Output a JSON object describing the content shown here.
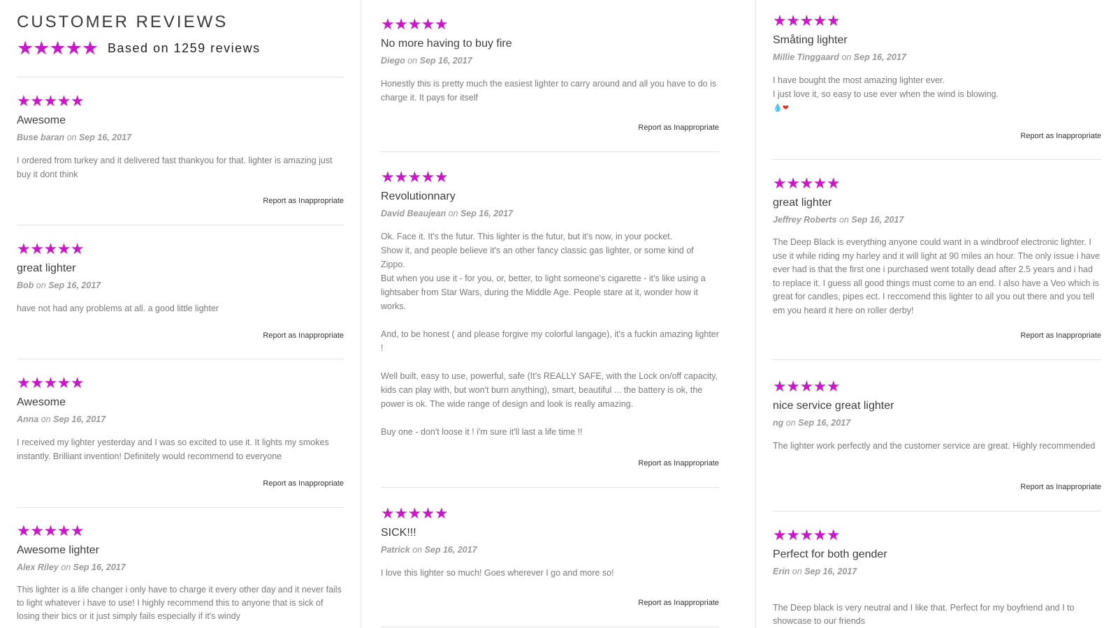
{
  "header": {
    "title": "CUSTOMER REVIEWS",
    "stars": "★★★★★",
    "summary": "Based on 1259 reviews"
  },
  "report_label": "Report as Inappropriate",
  "on_label": "on",
  "star_color": "#c818c8",
  "columns": [
    {
      "reviews": [
        {
          "rating": 5,
          "stars": "★★★★★",
          "title": "Awesome",
          "author": "Buse baran",
          "date": "Sep 16, 2017",
          "body": [
            "I ordered from turkey and it delivered fast thankyou for that. lighter is amazing just buy it dont think"
          ]
        },
        {
          "rating": 5,
          "stars": "★★★★★",
          "title": "great lighter",
          "author": "Bob",
          "date": "Sep 16, 2017",
          "body": [
            "have not had any problems at all. a good little lighter"
          ]
        },
        {
          "rating": 5,
          "stars": "★★★★★",
          "title": "Awesome",
          "author": "Anna",
          "date": "Sep 16, 2017",
          "body": [
            "I received my lighter yesterday and I was so excited to use it. It lights my smokes instantly. Brilliant invention! Definitely would recommend to everyone"
          ]
        },
        {
          "rating": 5,
          "stars": "★★★★★",
          "title": "Awesome lighter",
          "author": "Alex Riley",
          "date": "Sep 16, 2017",
          "body": [
            "This lighter is a life changer i only have to charge it every other day and it never fails to light whatever i have to use! I highly recommend this to anyone that is sick of losing their bics or it just simply fails especially if it's windy"
          ]
        }
      ]
    },
    {
      "reviews": [
        {
          "rating": 5,
          "stars": "★★★★★",
          "title": "No more having to buy fire",
          "author": "Diego",
          "date": "Sep 16, 2017",
          "body": [
            "Honestly this is pretty much the easiest lighter to carry around and all you have to do is charge it. It pays for itself"
          ]
        },
        {
          "rating": 5,
          "stars": "★★★★★",
          "title": "Revolutionnary",
          "author": "David Beaujean",
          "date": "Sep 16, 2017",
          "body": [
            "Ok. Face it. It's the futur. This lighter is the futur, but it's now, in your pocket.",
            "Show it, and people believe it's an other fancy classic gas lighter, or some kind of Zippo.",
            "But when you use it - for you, or, better, to light someone's cigarette - it's like using a lightsaber from Star Wars, during the Middle Age. People stare at it, wonder how it works.",
            "And, to be honest ( and please forgive my colorful langage), it's a fuckin amazing lighter !",
            "Well built, easy to use, powerful, safe (It's REALLY SAFE, with the Lock on/off capacity, kids can play with, but won't burn anything), smart, beautiful ... the battery is ok, the power is ok. The wide range of design and look is really amazing.",
            "Buy one - don't loose it ! i'm sure it'll last a life time !!"
          ]
        },
        {
          "rating": 5,
          "stars": "★★★★★",
          "title": "SICK!!!",
          "author": "Patrick",
          "date": "Sep 16, 2017",
          "body": [
            "I love this lighter so much! Goes wherever I go and more so!"
          ]
        }
      ]
    },
    {
      "reviews": [
        {
          "rating": 5,
          "stars": "★★★★★",
          "title": "Småting lighter",
          "author": "Millie Tinggaard",
          "date": "Sep 16, 2017",
          "body": [
            "I have bought the most amazing lighter ever.",
            "I just love it, so easy to use ever when the wind is blowing."
          ],
          "emoji": "💧❤"
        },
        {
          "rating": 5,
          "stars": "★★★★★",
          "title": "great lighter",
          "author": "Jeffrey Roberts",
          "date": "Sep 16, 2017",
          "body": [
            "The Deep Black is everything anyone could want in a windbroof electronic lighter. I use it while riding my harley and it will light at 90 miles an hour. The only issue i have ever had is that the first one i purchased went totally dead after 2.5 years and i had to replace it. I guess all good things must come to an end. I also have a Veo which is great for candles, pipes ect. I reccomend this lighter to all you out there and you tell em you heard it here on roller derby!"
          ]
        },
        {
          "rating": 5,
          "stars": "★★★★★",
          "title": "nice service great lighter",
          "author": "ng",
          "date": "Sep 16, 2017",
          "body": [
            "The lighter work perfectly and the customer service are great. Highly recommended"
          ]
        },
        {
          "rating": 5,
          "stars": "★★★★★",
          "title": "Perfect for both gender",
          "author": "Erin",
          "date": "Sep 16, 2017",
          "body": [
            "The Deep black is very neutral and I like that. Perfect for my boyfriend and I to showcase to our friends"
          ]
        }
      ]
    }
  ]
}
